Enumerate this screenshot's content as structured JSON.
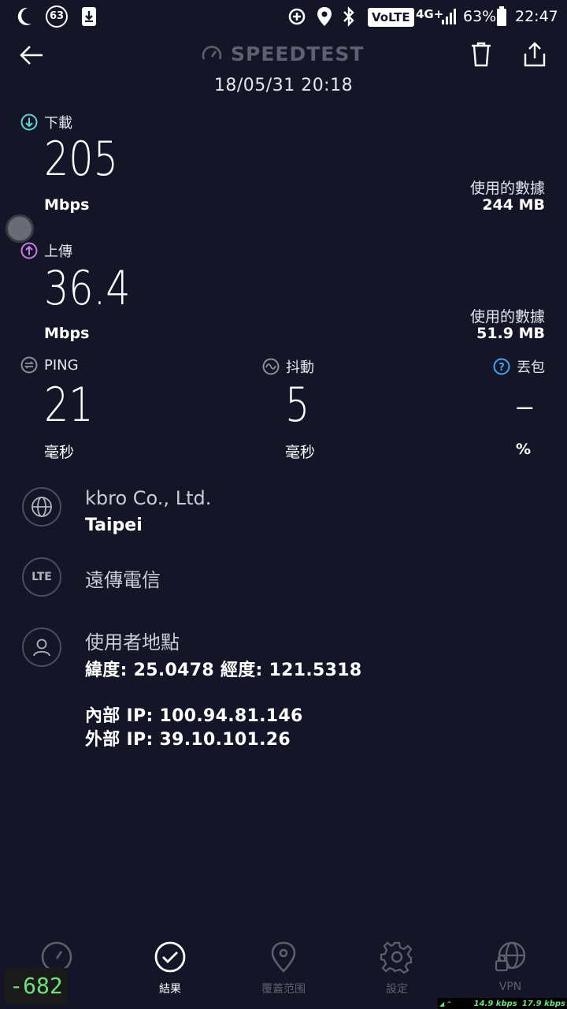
{
  "status_bar": {
    "notif_badge": "63",
    "volte": "VoLTE",
    "network": "4G+",
    "battery": "63%",
    "time": "22:47"
  },
  "header": {
    "brand": "SPEEDTEST",
    "datetime": "18/05/31 20:18"
  },
  "download": {
    "label": "下載",
    "value": "205",
    "unit": "Mbps",
    "data_label": "使用的數據",
    "data_value": "244 MB"
  },
  "upload": {
    "label": "上傳",
    "value": "36.4",
    "unit": "Mbps",
    "data_label": "使用的數據",
    "data_value": "51.9 MB"
  },
  "ping": {
    "label": "PING",
    "value": "21",
    "unit": "毫秒"
  },
  "jitter": {
    "label": "抖動",
    "value": "5",
    "unit": "毫秒"
  },
  "loss": {
    "label": "丟包",
    "value": "–",
    "unit": "%"
  },
  "provider": {
    "name": "kbro Co., Ltd.",
    "city": "Taipei"
  },
  "carrier": {
    "badge": "LTE",
    "name": "遠傳電信"
  },
  "location": {
    "title": "使用者地點",
    "coords": "緯度: 25.0478 經度: 121.5318",
    "internal_ip": "內部 IP: 100.94.81.146",
    "external_ip": "外部 IP: 39.10.101.26"
  },
  "nav": {
    "items": [
      {
        "label": "速度"
      },
      {
        "label": "結果"
      },
      {
        "label": "覆蓋范围"
      },
      {
        "label": "設定"
      },
      {
        "label": "VPN"
      }
    ]
  },
  "overlay": {
    "counter": "-682",
    "speed_down": "14.9 kbps",
    "speed_up": "17.9 kbps"
  },
  "colors": {
    "background": "#141526",
    "download_accent": "#5fd3d0",
    "upload_accent": "#c77ddf",
    "help_accent": "#3da5f4",
    "counter_green": "#6fe07a"
  }
}
